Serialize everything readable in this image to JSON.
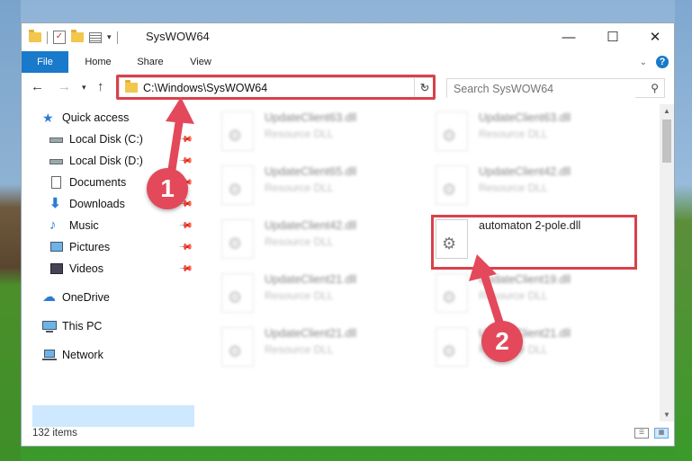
{
  "window": {
    "title": "SysWOW64",
    "minimize": "—",
    "maximize": "☐",
    "close": "✕"
  },
  "ribbon": {
    "tabs": [
      "File",
      "Home",
      "Share",
      "View"
    ],
    "collapse_icon": "chevron-down-icon",
    "help_icon": "?"
  },
  "address": {
    "path": "C:\\Windows\\SysWOW64",
    "refresh_icon": "↻"
  },
  "search": {
    "placeholder": "Search SysWOW64"
  },
  "sidebar": {
    "items": [
      {
        "label": "Quick access",
        "icon": "star-icon",
        "pinned": false
      },
      {
        "label": "Local Disk (C:)",
        "icon": "drive-icon",
        "pinned": true
      },
      {
        "label": "Local Disk (D:)",
        "icon": "drive-icon",
        "pinned": true
      },
      {
        "label": "Documents",
        "icon": "documents-icon",
        "pinned": true
      },
      {
        "label": "Downloads",
        "icon": "download-icon",
        "pinned": true
      },
      {
        "label": "Music",
        "icon": "music-icon",
        "pinned": true
      },
      {
        "label": "Pictures",
        "icon": "pictures-icon",
        "pinned": true
      },
      {
        "label": "Videos",
        "icon": "videos-icon",
        "pinned": true
      },
      {
        "label": "OneDrive",
        "icon": "cloud-icon",
        "pinned": false
      },
      {
        "label": "This PC",
        "icon": "computer-icon",
        "pinned": false,
        "selected": true
      },
      {
        "label": "Network",
        "icon": "network-icon",
        "pinned": false
      }
    ]
  },
  "files": [
    {
      "name": "UpdateClient63.dll",
      "type": "Resource DLL",
      "blurred": true
    },
    {
      "name": "UpdateClient63.dll",
      "type": "Resource DLL",
      "blurred": true
    },
    {
      "name": "UpdateClient65.dll",
      "type": "Resource DLL",
      "blurred": true
    },
    {
      "name": "UpdateClient42.dll",
      "type": "Resource DLL",
      "blurred": true
    },
    {
      "name": "UpdateClient42.dll",
      "type": "Resource DLL",
      "blurred": true
    },
    {
      "name": "automaton 2-pole.dll",
      "type": "",
      "blurred": false,
      "highlighted": true
    },
    {
      "name": "UpdateClient21.dll",
      "type": "Resource DLL",
      "blurred": true
    },
    {
      "name": "UpdateClient19.dll",
      "type": "Resource DLL",
      "blurred": true
    },
    {
      "name": "UpdateClient21.dll",
      "type": "Resource DLL",
      "blurred": true
    },
    {
      "name": "UpdateClient21.dll",
      "type": "Resource DLL",
      "blurred": true
    }
  ],
  "status": {
    "item_count": "132 items"
  },
  "annotations": {
    "step1": "1",
    "step2": "2",
    "color": "#e3495a"
  }
}
